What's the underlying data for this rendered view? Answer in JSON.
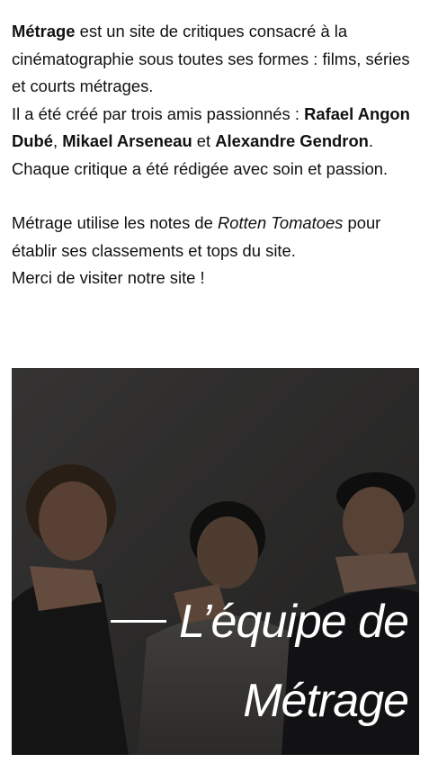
{
  "intro": {
    "site_name": "Métrage",
    "line1_rest": " est un site de critiques consacré à la cinématographie sous toutes ses formes : films, séries et courts métrages.",
    "line2_prefix": "Il a été créé par trois amis passionnés : ",
    "founder1": "Rafael Angon Dubé",
    "sep1": ", ",
    "founder2": "Mikael Arseneau",
    "sep2": " et ",
    "founder3": "Alexandre Gendron",
    "line2_end": ".",
    "line3": "Chaque critique a été rédigée avec soin et passion."
  },
  "ratings": {
    "prefix": "Métrage utilise les notes de ",
    "source": "Rotten Tomatoes",
    "suffix": " pour établir ses classements et tops du site.",
    "thanks": "Merci de visiter notre site !"
  },
  "team_photo": {
    "caption_line1": "L’équipe de",
    "caption_line2": "Métrage"
  },
  "colors": {
    "text": "#111111",
    "photo_bg": "#2b2a29",
    "caption": "#ffffff"
  }
}
